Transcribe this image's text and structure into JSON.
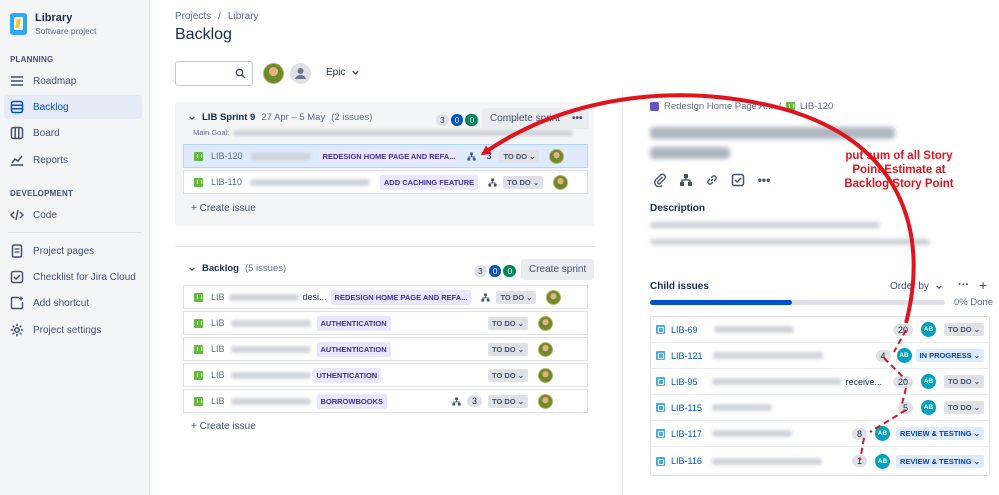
{
  "sidebar": {
    "project_name": "Library",
    "project_type": "Software project",
    "sections": [
      {
        "title": "PLANNING"
      },
      {
        "title": "DEVELOPMENT"
      }
    ],
    "items": [
      {
        "label": "Roadmap",
        "icon": "roadmap-icon"
      },
      {
        "label": "Backlog",
        "icon": "backlog-icon",
        "active": true
      },
      {
        "label": "Board",
        "icon": "board-icon"
      },
      {
        "label": "Reports",
        "icon": "reports-icon"
      },
      {
        "label": "Code",
        "icon": "code-icon"
      },
      {
        "label": "Project pages",
        "icon": "pages-icon"
      },
      {
        "label": "Checklist for Jira Cloud",
        "icon": "checklist-icon"
      },
      {
        "label": "Add shortcut",
        "icon": "add-shortcut-icon"
      },
      {
        "label": "Project settings",
        "icon": "gear-icon"
      }
    ]
  },
  "header": {
    "breadcrumbs": [
      "Projects",
      "/",
      "Library"
    ],
    "title": "Backlog",
    "epic_filter": "Epic"
  },
  "sprint": {
    "name": "LIB Sprint 9",
    "dates": "27 Apr – 5 May",
    "issue_count": "(2 issues)",
    "goal_label": "Main Goal:",
    "counts": [
      "3",
      "0",
      "0"
    ],
    "complete_button": "Complete sprint",
    "more": "•••",
    "issues": [
      {
        "key": "LIB-120",
        "epic": "REDESIGN HOME PAGE AND REFA...",
        "points": "3",
        "status": "TO DO"
      },
      {
        "key": "LIB-110",
        "epic": "ADD CACHING FEATURE",
        "points": "",
        "status": "TO DO"
      }
    ],
    "create_issue": "+ Create issue"
  },
  "backlog": {
    "name": "Backlog",
    "issue_count": "(5 issues)",
    "counts": [
      "3",
      "0",
      "0"
    ],
    "create_sprint": "Create sprint",
    "issues": [
      {
        "key": "LIB",
        "text": "desi...",
        "epic": "REDESIGN HOME PAGE AND REFA...",
        "points": "",
        "status": "TO DO"
      },
      {
        "key": "LIB",
        "text": "",
        "epic": "AUTHENTICATION",
        "points": "",
        "status": "TO DO"
      },
      {
        "key": "LIB",
        "text": "",
        "epic": "AUTHENTICATION",
        "points": "",
        "status": "TO DO"
      },
      {
        "key": "LIB",
        "text": "",
        "epic": "UTHENTICATION",
        "points": "",
        "status": "TO DO"
      },
      {
        "key": "LIB",
        "text": "",
        "epic": "BORROWBOOKS",
        "points": "3",
        "status": "TO DO"
      }
    ],
    "create_issue": "+ Create issue"
  },
  "detail": {
    "breadcrumb_epic": "Redesign Home Page A...",
    "breadcrumb_sep": "/",
    "breadcrumb_key": "LIB-120",
    "description_label": "Description",
    "child_issues_label": "Child issues",
    "order_by": "Order by",
    "progress_text": "0% Done",
    "progress_fraction": 0.48,
    "children": [
      {
        "key": "LIB-69",
        "text": "",
        "points": "20",
        "avatar": "AB",
        "status": "TO DO",
        "status_kind": "todo"
      },
      {
        "key": "LIB-121",
        "text": "",
        "points": "4",
        "avatar": "AB",
        "status": "IN PROGRESS",
        "status_kind": "prog"
      },
      {
        "key": "LIB-95",
        "text": "receive...",
        "points": "20",
        "avatar": "AB",
        "status": "TO DO",
        "status_kind": "todo"
      },
      {
        "key": "LIB-115",
        "text": "",
        "points": "5",
        "avatar": "AB",
        "status": "TO DO",
        "status_kind": "todo"
      },
      {
        "key": "LIB-117",
        "text": "",
        "points": "8",
        "avatar": "AB",
        "status": "REVIEW & TESTING",
        "status_kind": "rev"
      },
      {
        "key": "LIB-116",
        "text": "",
        "points": "1",
        "avatar": "AB",
        "status": "REVIEW & TESTING",
        "status_kind": "rev"
      }
    ]
  },
  "annotation": {
    "line1": "put sum of all Story",
    "line2": "Point Estimate at",
    "line3": "Backlog Story Point",
    "color": "#e0141e"
  }
}
